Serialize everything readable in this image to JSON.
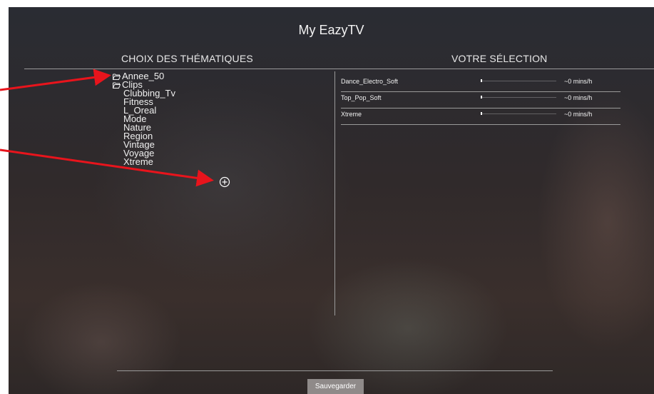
{
  "app": {
    "title": "My EazyTV"
  },
  "themes": {
    "heading": "CHOIX DES THÉMATIQUES",
    "folders": [
      {
        "label": "Annee_50",
        "icon": "folder-open-icon"
      },
      {
        "label": "Clips",
        "icon": "folder-open-icon"
      }
    ],
    "items": [
      "Clubbing_Tv",
      "Fitness",
      "L_Oreal",
      "Mode",
      "Nature",
      "Region",
      "Vintage",
      "Voyage",
      "Xtreme"
    ],
    "add_icon": "plus-circle-icon"
  },
  "selection": {
    "heading": "VOTRE SÉLECTION",
    "rows": [
      {
        "name": "Dance_Electro_Soft",
        "time": "~0 mins/h",
        "level": 0
      },
      {
        "name": "Top_Pop_Soft",
        "time": "~0 mins/h",
        "level": 0
      },
      {
        "name": "Xtreme",
        "time": "~0 mins/h",
        "level": 0
      }
    ]
  },
  "footer": {
    "save_label": "Sauvegarder"
  },
  "annotation": {
    "arrow_color": "#e8141c"
  }
}
